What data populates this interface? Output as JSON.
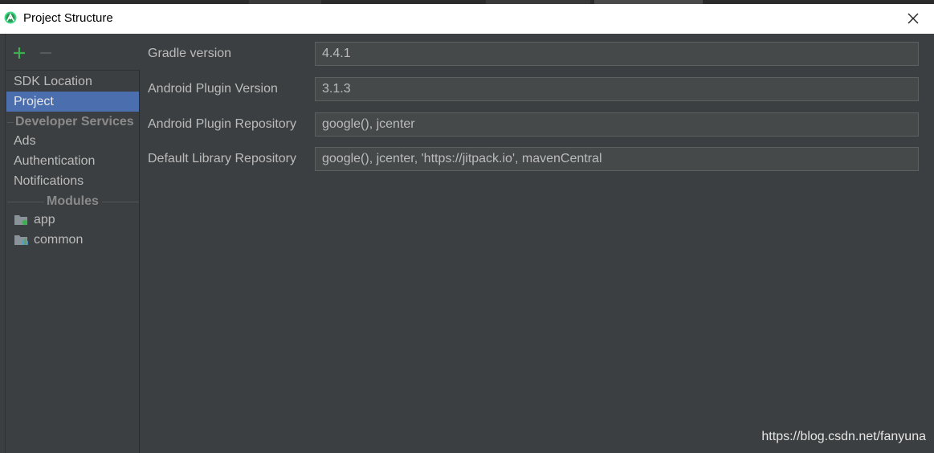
{
  "window": {
    "title": "Project Structure"
  },
  "toolbar": {
    "add_icon": "plus-icon",
    "remove_icon": "minus-icon"
  },
  "sidebar": {
    "items": [
      {
        "label": "SDK Location",
        "selected": false
      },
      {
        "label": "Project",
        "selected": true
      }
    ],
    "developer_services_header": "Developer Services",
    "developer_services": [
      {
        "label": "Ads"
      },
      {
        "label": "Authentication"
      },
      {
        "label": "Notifications"
      }
    ],
    "modules_header": "Modules",
    "modules": [
      {
        "label": "app",
        "icon": "android-module-folder-icon"
      },
      {
        "label": "common",
        "icon": "library-module-folder-icon"
      }
    ]
  },
  "project": {
    "fields": [
      {
        "label": "Gradle version",
        "value": "4.4.1"
      },
      {
        "label": "Android Plugin Version",
        "value": "3.1.3"
      },
      {
        "label": "Android Plugin Repository",
        "value": "google(), jcenter"
      },
      {
        "label": "Default Library Repository",
        "value": "google(), jcenter, 'https://jitpack.io', mavenCentral"
      }
    ]
  },
  "watermark": "https://blog.csdn.net/fanyuna",
  "colors": {
    "background": "#3c3f41",
    "selection": "#4b6eaf",
    "text": "#bbbbbb",
    "accent_green": "#3dae52",
    "field_bg": "#45494a"
  }
}
